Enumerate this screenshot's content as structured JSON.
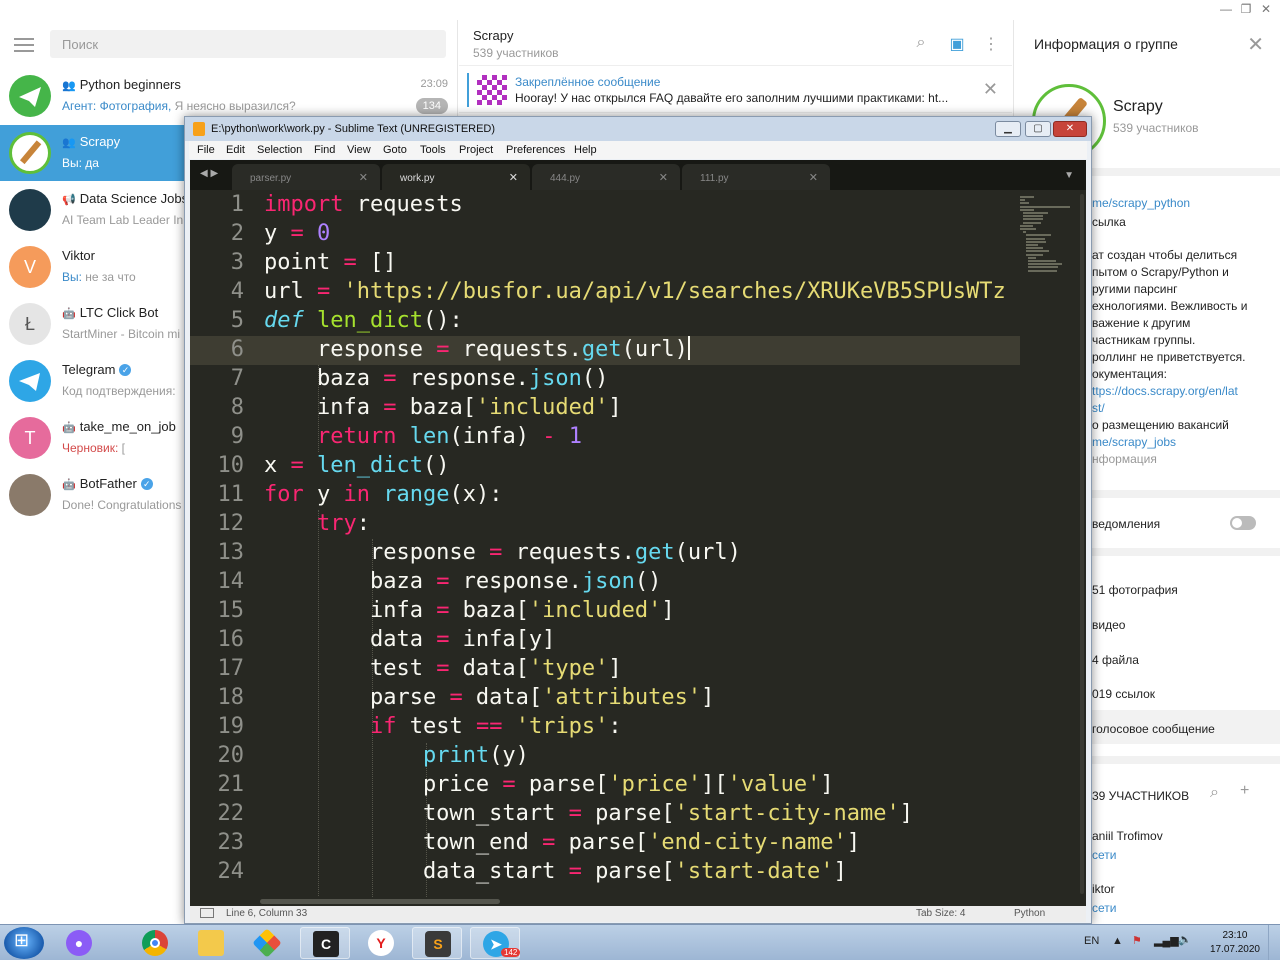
{
  "telegram": {
    "search_placeholder": "Поиск",
    "chats": [
      {
        "name": "Python beginners",
        "time": "23:09",
        "sub_prefix": "Агент: Фотография, ",
        "sub_rest": "Я неясно выразился?",
        "badge": "134",
        "avatar_color": "#45b549",
        "group": true
      },
      {
        "name": "Scrapy",
        "sub_prefix": "Вы: да",
        "sub_rest": "",
        "avatar_color": "#ffffff",
        "group": true,
        "active": true
      },
      {
        "name": "Data Science Jobs",
        "sub_prefix": "",
        "sub_rest": "AI Team Lab Leader In",
        "avatar_color": "#1f3b4a",
        "channel": true
      },
      {
        "name": "Viktor",
        "sub_prefix": "Вы: ",
        "sub_rest": "не за что",
        "avatar_color": "#f59b5b",
        "avatar_letter": "V"
      },
      {
        "name": "LTC Click Bot",
        "sub_prefix": "",
        "sub_rest": "StartMiner - Bitcoin mi",
        "avatar_color": "#dddddd",
        "bot": true
      },
      {
        "name": "Telegram",
        "sub_prefix": "",
        "sub_rest": "Код подтверждения: ",
        "avatar_color": "#2ea6e6",
        "verified": true
      },
      {
        "name": "take_me_on_job",
        "sub_prefix": "Черновик: ",
        "sub_rest": "[",
        "avatar_color": "#e66b9c",
        "avatar_letter": "T",
        "bot": true
      },
      {
        "name": "BotFather",
        "sub_prefix": "",
        "sub_rest": "Done! Congratulations",
        "avatar_color": "#8a7a6a",
        "bot": true,
        "verified": true
      }
    ],
    "header": {
      "title": "Scrapy",
      "subtitle": "539 участников"
    },
    "pinned": {
      "title": "Закреплённое сообщение",
      "text": "Hooray! У нас открылся FAQ давайте его заполним лучшими практиками: ht..."
    },
    "info": {
      "title": "Информация о группе",
      "group_name": "Scrapy",
      "group_count": "539 участников",
      "link": "me/scrapy_python",
      "link_label": "сылка",
      "desc_lines": [
        "ат создан чтобы делиться",
        "пытом о Scrapy/Python и",
        "ругими парсинг",
        "ехнологиями. Вежливость и",
        "важение к другим",
        "частникам группы.",
        "роллинг не приветствуется.",
        "окументация:"
      ],
      "doc_link_1": "ttps://docs.scrapy.org/en/lat",
      "doc_link_2": "st/",
      "jobs_label": "о размещению вакансий",
      "jobs_link": "me/scrapy_jobs",
      "info_label": "нформация",
      "notifications": "ведомления",
      "media": [
        "51 фотография",
        " видео",
        "4 файла",
        "019 ссылок",
        " голосовое сообщение"
      ],
      "members_title": "39 УЧАСТНИКОВ",
      "members": [
        {
          "name": "aniil Trofimov",
          "status": " сети"
        },
        {
          "name": "iktor",
          "status": " сети"
        }
      ]
    }
  },
  "sublime": {
    "title": "E:\\python\\work\\work.py - Sublime Text (UNREGISTERED)",
    "menu": [
      "File",
      "Edit",
      "Selection",
      "Find",
      "View",
      "Goto",
      "Tools",
      "Project",
      "Preferences",
      "Help"
    ],
    "tabs": [
      "parser.py",
      "work.py",
      "444.py",
      "111.py"
    ],
    "active_tab": 1,
    "status_left": "Line 6, Column 33",
    "status_tab": "Tab Size: 4",
    "status_syntax": "Python",
    "line_numbers": [
      "1",
      "2",
      "3",
      "4",
      "5",
      "6",
      "7",
      "8",
      "9",
      "10",
      "11",
      "12",
      "13",
      "14",
      "15",
      "16",
      "17",
      "18",
      "19",
      "20",
      "21",
      "22",
      "23",
      "24"
    ],
    "code_lines": [
      "import requests",
      "y = 0",
      "point = []",
      "url = 'https://busfor.ua/api/v1/searches/XRUKeVB5SPUsWTz",
      "def len_dict():",
      "    response = requests.get(url)",
      "    baza = response.json()",
      "    infa = baza['included']",
      "    return len(infa) - 1",
      "x = len_dict()",
      "for y in range(x):",
      "    try:",
      "        response = requests.get(url)",
      "        baza = response.json()",
      "        infa = baza['included']",
      "        data = infa[y]",
      "        test = data['type']",
      "        parse = data['attributes']",
      "        if test == 'trips':",
      "            print(y)",
      "            price = parse['price']['value']",
      "            town_start = parse['start-city-name']",
      "            town_end = parse['end-city-name']",
      "            data_start = parse['start-date']"
    ]
  },
  "taskbar": {
    "lang": "EN",
    "time": "23:10",
    "date": "17.07.2020",
    "telegram_badge": "142"
  }
}
